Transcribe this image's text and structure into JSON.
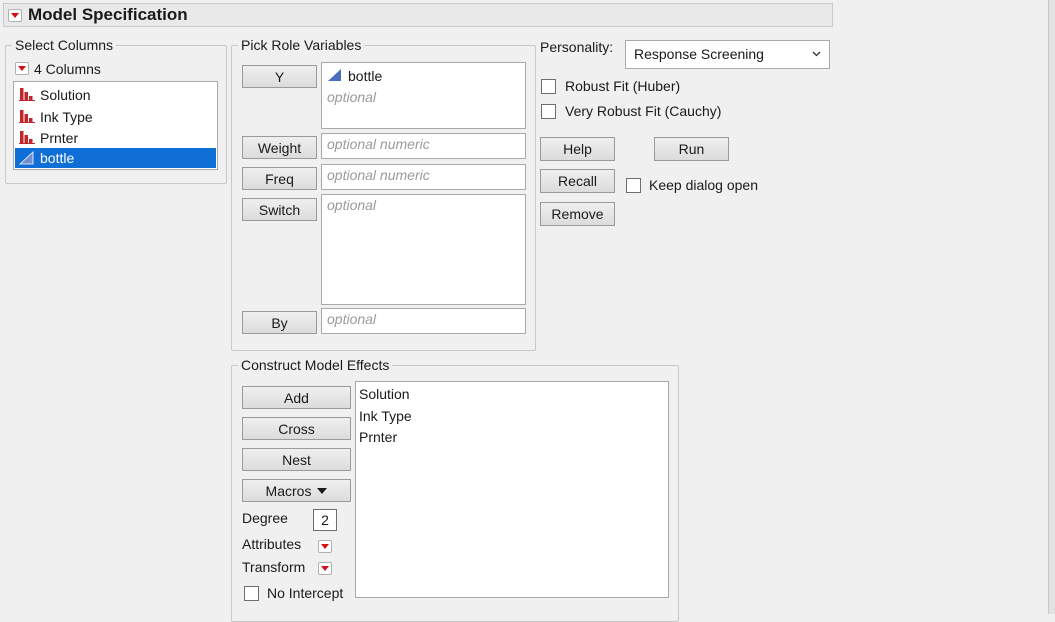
{
  "title": "Model Specification",
  "select_columns": {
    "label": "Select Columns",
    "count_label": "4 Columns",
    "items": [
      {
        "label": "Solution",
        "icon": "nominal-bars-icon",
        "selected": false
      },
      {
        "label": "Ink Type",
        "icon": "nominal-bars-icon",
        "selected": false
      },
      {
        "label": "Prnter",
        "icon": "nominal-bars-icon",
        "selected": false
      },
      {
        "label": "bottle",
        "icon": "continuous-triangle-icon",
        "selected": true
      }
    ]
  },
  "pick_roles": {
    "label": "Pick Role Variables",
    "y": {
      "button": "Y",
      "value": "bottle",
      "placeholder": "optional"
    },
    "weight": {
      "button": "Weight",
      "placeholder": "optional numeric"
    },
    "freq": {
      "button": "Freq",
      "placeholder": "optional numeric"
    },
    "switch": {
      "button": "Switch",
      "placeholder": "optional"
    },
    "by": {
      "button": "By",
      "placeholder": "optional"
    }
  },
  "personality": {
    "label": "Personality:",
    "value": "Response Screening"
  },
  "options": {
    "robust_fit": "Robust Fit (Huber)",
    "very_robust_fit": "Very Robust Fit (Cauchy)",
    "keep_dialog_open": "Keep dialog open"
  },
  "actions": {
    "help": "Help",
    "run": "Run",
    "recall": "Recall",
    "remove": "Remove"
  },
  "construct": {
    "label": "Construct Model Effects",
    "add": "Add",
    "cross": "Cross",
    "nest": "Nest",
    "macros": "Macros",
    "degree_label": "Degree",
    "degree_value": "2",
    "attributes_label": "Attributes",
    "transform_label": "Transform",
    "no_intercept": "No Intercept",
    "effects": [
      "Solution",
      "Ink Type",
      "Prnter"
    ]
  },
  "colors": {
    "accent_red": "#d0101a",
    "selection_blue": "#0f6fd6"
  }
}
